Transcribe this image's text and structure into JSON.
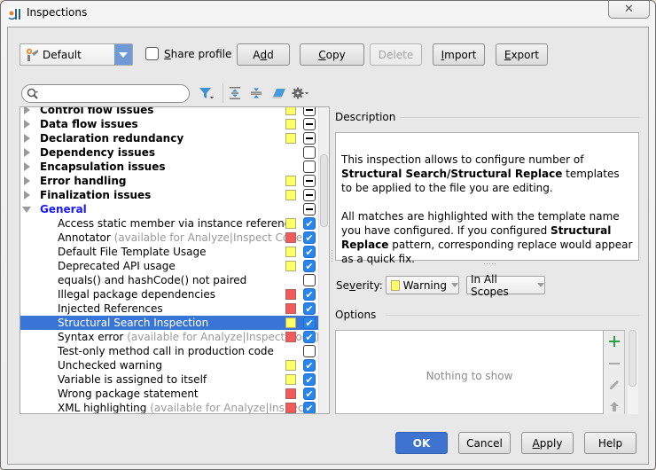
{
  "window": {
    "title": "Inspections",
    "close_glyph": "✕"
  },
  "profile": {
    "selected": "Default",
    "share_label_prefix": "",
    "share_label_mnemonic": "S",
    "share_label_rest": "hare profile",
    "share_checked": false
  },
  "buttons": {
    "add": {
      "pre": "A",
      "mn": "d",
      "post": "d"
    },
    "copy": {
      "pre": "",
      "mn": "C",
      "post": "opy"
    },
    "delete": {
      "pre": "Delete",
      "mn": "",
      "post": ""
    },
    "import": {
      "pre": "",
      "mn": "I",
      "post": "mport"
    },
    "export": {
      "pre": "",
      "mn": "E",
      "post": "xport"
    }
  },
  "search": {
    "value": "",
    "placeholder": ""
  },
  "toolbar": {
    "icons": [
      "filter-icon",
      "expand-all-icon",
      "collapse-all-icon",
      "reset-icon",
      "settings-icon"
    ]
  },
  "tree": {
    "rows": [
      {
        "name": "Control flow issues",
        "group": true,
        "expanded": false,
        "severity": "warning",
        "check": "partial"
      },
      {
        "name": "Data flow issues",
        "group": true,
        "expanded": false,
        "severity": "warning",
        "check": "partial"
      },
      {
        "name": "Declaration redundancy",
        "group": true,
        "expanded": false,
        "severity": "warning",
        "check": "partial"
      },
      {
        "name": "Dependency issues",
        "group": true,
        "expanded": false,
        "severity": "",
        "check": "unchecked"
      },
      {
        "name": "Encapsulation issues",
        "group": true,
        "expanded": false,
        "severity": "",
        "check": "unchecked"
      },
      {
        "name": "Error handling",
        "group": true,
        "expanded": false,
        "severity": "warning",
        "check": "partial"
      },
      {
        "name": "Finalization issues",
        "group": true,
        "expanded": false,
        "severity": "warning",
        "check": "partial"
      },
      {
        "name": "General",
        "group": true,
        "expanded": true,
        "blue": true,
        "severity": "",
        "check": "partial"
      },
      {
        "name": "Access static member via instance reference",
        "severity": "warning",
        "check": "checked"
      },
      {
        "name": "Annotator",
        "hint": "(available for Analyze|Inspect Code)",
        "severity": "error",
        "check": "checked"
      },
      {
        "name": "Default File Template Usage",
        "severity": "warning",
        "check": "checked"
      },
      {
        "name": "Deprecated API usage",
        "severity": "warning",
        "check": "checked"
      },
      {
        "name": "equals() and hashCode() not paired",
        "severity": "",
        "check": "unchecked"
      },
      {
        "name": "Illegal package dependencies",
        "severity": "error",
        "check": "checked"
      },
      {
        "name": "Injected References",
        "severity": "error",
        "check": "checked"
      },
      {
        "name": "Structural Search Inspection",
        "severity": "warning",
        "check": "checked",
        "selected": true
      },
      {
        "name": "Syntax error",
        "hint": "(available for Analyze|Inspect Code)",
        "severity": "error",
        "check": "checked"
      },
      {
        "name": "Test-only method call in production code",
        "severity": "",
        "check": "unchecked"
      },
      {
        "name": "Unchecked warning",
        "severity": "warning",
        "check": "checked"
      },
      {
        "name": "Variable is assigned to itself",
        "severity": "warning",
        "check": "checked"
      },
      {
        "name": "Wrong package statement",
        "severity": "error",
        "check": "checked"
      },
      {
        "name": "XML highlighting",
        "hint": "(available for Analyze|Inspect",
        "severity": "error",
        "check": "checked"
      }
    ]
  },
  "description": {
    "title": "Description",
    "p1_a": "This inspection allows to configure number of ",
    "p1_b": "Structural Search/Structural Replace",
    "p1_c": " templates to be applied to the file you are editing.",
    "p2_a": "All matches are highlighted with the template name you have configured. If you configured ",
    "p2_b": "Structural Replace",
    "p2_c": " pattern, corresponding replace would appear as a quick fix."
  },
  "severity": {
    "label_pre": "Se",
    "label_mn": "v",
    "label_post": "erity:",
    "value": "Warning",
    "scope": "In All Scopes"
  },
  "options": {
    "title": "Options",
    "empty_text": "Nothing to show"
  },
  "footer": {
    "ok": "OK",
    "cancel": "Cancel",
    "apply_mn": "A",
    "apply_rest": "pply",
    "help": "Help"
  },
  "colors": {
    "warning": "#ffff66",
    "error": "#f05a5a",
    "selection": "#3875d7",
    "checkbox": "#2b85e8",
    "primary_button": "#3e74cf"
  }
}
